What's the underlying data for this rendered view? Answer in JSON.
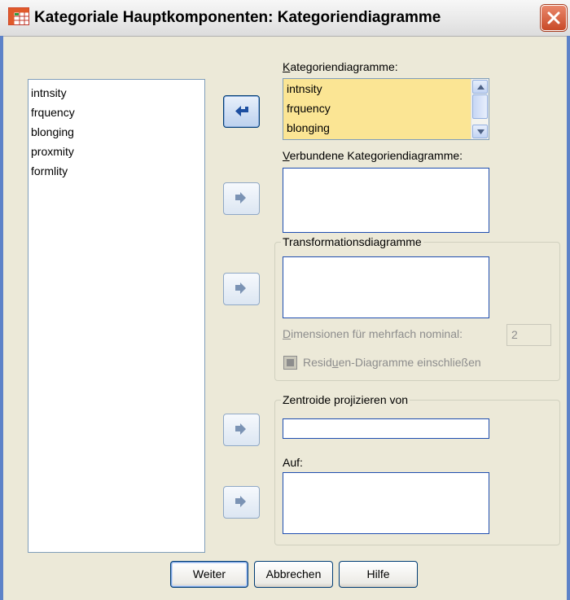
{
  "window": {
    "title": "Kategoriale Hauptkomponenten: Kategoriendiagramme",
    "icon": "spss-table-icon",
    "close_icon": "close-icon"
  },
  "source_variables": [
    "intnsity",
    "frquency",
    "blonging",
    "proxmity",
    "formlity"
  ],
  "category_plots": {
    "label_first": "K",
    "label_rest": "ategoriendiagramme:",
    "items": [
      "intnsity",
      "frquency",
      "blonging"
    ]
  },
  "joint_category_plots": {
    "label_first": "V",
    "label_rest": "erbundene Kategoriendiagramme:",
    "items": []
  },
  "transformation_plots": {
    "legend": "Transformationsdiagramme",
    "items": [],
    "dimensions_label_first": "D",
    "dimensions_label_rest": "imensionen für mehrfach nominal:",
    "dimensions_value": "2",
    "residuals_prefix": "Resid",
    "residuals_u": "u",
    "residuals_rest": "en-Diagramme einschließen",
    "residuals_checked": false
  },
  "project_centroids": {
    "legend": "Zentroide projizieren von",
    "from_value": "",
    "onto_label": "Auf:",
    "onto_items": []
  },
  "buttons": {
    "continue": "Weiter",
    "cancel": "Abbrechen",
    "help": "Hilfe"
  },
  "colors": {
    "dialog_bg": "#ece9d8",
    "selection_bg": "#fbe594",
    "frame": "#5d82c8"
  }
}
